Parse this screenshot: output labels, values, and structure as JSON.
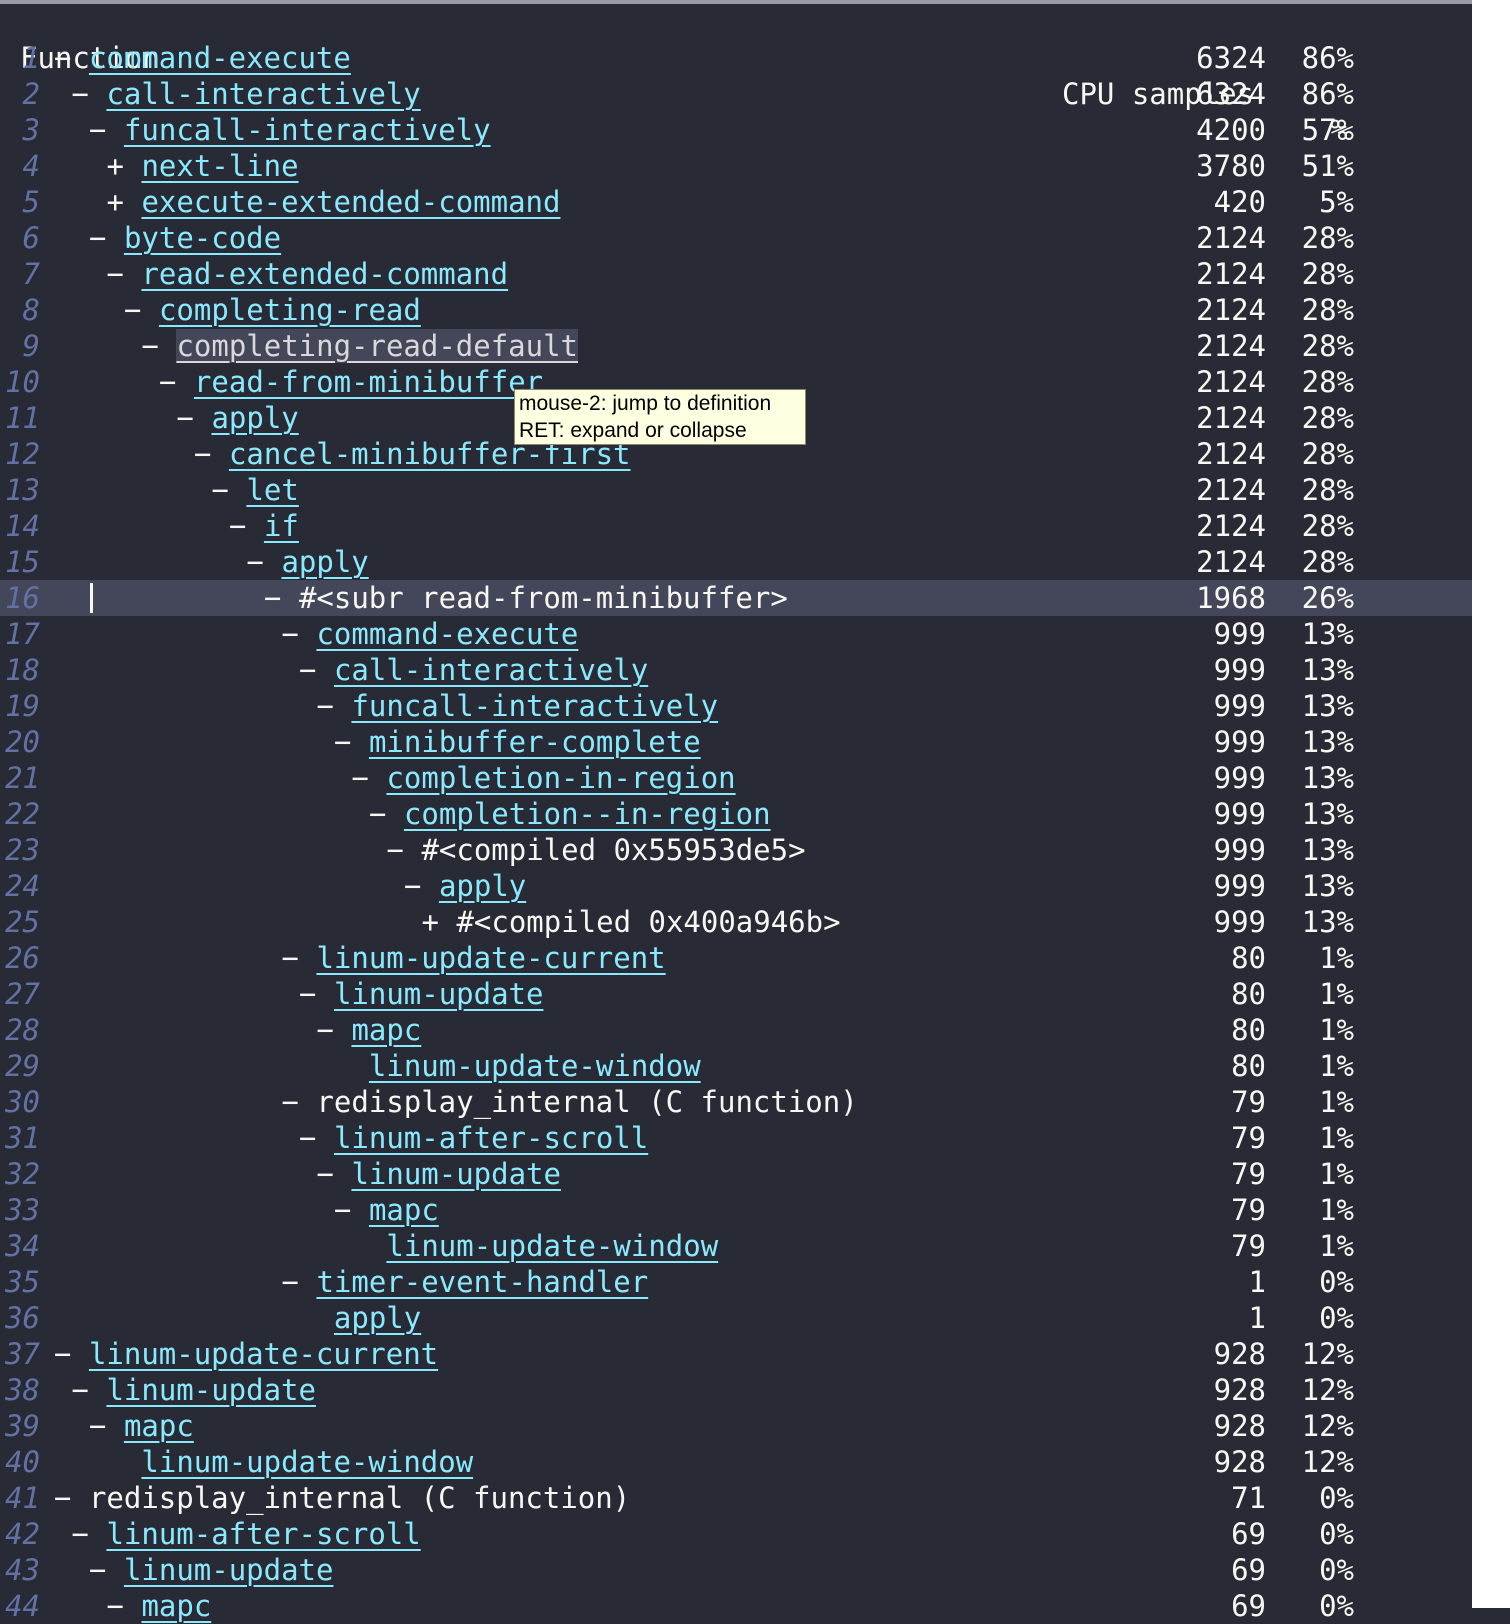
{
  "header": {
    "function": "Function",
    "cpu_samples": "CPU samples",
    "percent": "%"
  },
  "tooltip": {
    "line1": "mouse-2: jump to definition",
    "line2": "RET: expand or collapse"
  },
  "colors": {
    "background": "#282a36",
    "link": "#8be9fd",
    "line_number": "#6272a4",
    "current_line": "#44475a",
    "tooltip_bg": "#ffffe1"
  },
  "rows": [
    {
      "n": "1",
      "indent": 0,
      "sym": "−",
      "name": "command-execute",
      "link": true,
      "samples": "6324",
      "pct": "86%"
    },
    {
      "n": "2",
      "indent": 1,
      "sym": "−",
      "name": "call-interactively",
      "link": true,
      "samples": "6324",
      "pct": "86%"
    },
    {
      "n": "3",
      "indent": 2,
      "sym": "−",
      "name": "funcall-interactively",
      "link": true,
      "samples": "4200",
      "pct": "57%"
    },
    {
      "n": "4",
      "indent": 3,
      "sym": "+",
      "name": "next-line",
      "link": true,
      "samples": "3780",
      "pct": "51%"
    },
    {
      "n": "5",
      "indent": 3,
      "sym": "+",
      "name": "execute-extended-command",
      "link": true,
      "samples": "420",
      "pct": "5%"
    },
    {
      "n": "6",
      "indent": 2,
      "sym": "−",
      "name": "byte-code",
      "link": true,
      "samples": "2124",
      "pct": "28%"
    },
    {
      "n": "7",
      "indent": 3,
      "sym": "−",
      "name": "read-extended-command",
      "link": true,
      "samples": "2124",
      "pct": "28%"
    },
    {
      "n": "8",
      "indent": 4,
      "sym": "−",
      "name": "completing-read",
      "link": true,
      "samples": "2124",
      "pct": "28%"
    },
    {
      "n": "9",
      "indent": 5,
      "sym": "−",
      "name": "completing-read-default",
      "link": true,
      "hover": true,
      "samples": "2124",
      "pct": "28%"
    },
    {
      "n": "10",
      "indent": 6,
      "sym": "−",
      "name": "read-from-minibuffer",
      "link": true,
      "samples": "2124",
      "pct": "28%"
    },
    {
      "n": "11",
      "indent": 7,
      "sym": "−",
      "name": "apply",
      "link": true,
      "samples": "2124",
      "pct": "28%"
    },
    {
      "n": "12",
      "indent": 8,
      "sym": "−",
      "name": "cancel-minibuffer-first",
      "link": true,
      "samples": "2124",
      "pct": "28%"
    },
    {
      "n": "13",
      "indent": 9,
      "sym": "−",
      "name": "let",
      "link": true,
      "samples": "2124",
      "pct": "28%"
    },
    {
      "n": "14",
      "indent": 10,
      "sym": "−",
      "name": "if",
      "link": true,
      "samples": "2124",
      "pct": "28%"
    },
    {
      "n": "15",
      "indent": 11,
      "sym": "−",
      "name": "apply",
      "link": true,
      "samples": "2124",
      "pct": "28%"
    },
    {
      "n": "16",
      "indent": 12,
      "sym": "−",
      "name": "#<subr read-from-minibuffer>",
      "link": false,
      "current": true,
      "samples": "1968",
      "pct": "26%"
    },
    {
      "n": "17",
      "indent": 13,
      "sym": "−",
      "name": "command-execute",
      "link": true,
      "samples": "999",
      "pct": "13%"
    },
    {
      "n": "18",
      "indent": 14,
      "sym": "−",
      "name": "call-interactively",
      "link": true,
      "samples": "999",
      "pct": "13%"
    },
    {
      "n": "19",
      "indent": 15,
      "sym": "−",
      "name": "funcall-interactively",
      "link": true,
      "samples": "999",
      "pct": "13%"
    },
    {
      "n": "20",
      "indent": 16,
      "sym": "−",
      "name": "minibuffer-complete",
      "link": true,
      "samples": "999",
      "pct": "13%"
    },
    {
      "n": "21",
      "indent": 17,
      "sym": "−",
      "name": "completion-in-region",
      "link": true,
      "samples": "999",
      "pct": "13%"
    },
    {
      "n": "22",
      "indent": 18,
      "sym": "−",
      "name": "completion--in-region",
      "link": true,
      "samples": "999",
      "pct": "13%"
    },
    {
      "n": "23",
      "indent": 19,
      "sym": "−",
      "name": "#<compiled 0x55953de5>",
      "link": false,
      "samples": "999",
      "pct": "13%"
    },
    {
      "n": "24",
      "indent": 20,
      "sym": "−",
      "name": "apply",
      "link": true,
      "samples": "999",
      "pct": "13%"
    },
    {
      "n": "25",
      "indent": 21,
      "sym": "+",
      "name": "#<compiled 0x400a946b>",
      "link": false,
      "samples": "999",
      "pct": "13%"
    },
    {
      "n": "26",
      "indent": 13,
      "sym": "−",
      "name": "linum-update-current",
      "link": true,
      "samples": "80",
      "pct": "1%"
    },
    {
      "n": "27",
      "indent": 14,
      "sym": "−",
      "name": "linum-update",
      "link": true,
      "samples": "80",
      "pct": "1%"
    },
    {
      "n": "28",
      "indent": 15,
      "sym": "−",
      "name": "mapc",
      "link": true,
      "samples": "80",
      "pct": "1%"
    },
    {
      "n": "29",
      "indent": 16,
      "sym": "",
      "name": "linum-update-window",
      "link": true,
      "samples": "80",
      "pct": "1%"
    },
    {
      "n": "30",
      "indent": 13,
      "sym": "−",
      "name": "redisplay_internal (C function)",
      "link": false,
      "samples": "79",
      "pct": "1%"
    },
    {
      "n": "31",
      "indent": 14,
      "sym": "−",
      "name": "linum-after-scroll",
      "link": true,
      "samples": "79",
      "pct": "1%"
    },
    {
      "n": "32",
      "indent": 15,
      "sym": "−",
      "name": "linum-update",
      "link": true,
      "samples": "79",
      "pct": "1%"
    },
    {
      "n": "33",
      "indent": 16,
      "sym": "−",
      "name": "mapc",
      "link": true,
      "samples": "79",
      "pct": "1%"
    },
    {
      "n": "34",
      "indent": 17,
      "sym": "",
      "name": "linum-update-window",
      "link": true,
      "samples": "79",
      "pct": "1%"
    },
    {
      "n": "35",
      "indent": 13,
      "sym": "−",
      "name": "timer-event-handler",
      "link": true,
      "samples": "1",
      "pct": "0%"
    },
    {
      "n": "36",
      "indent": 14,
      "sym": "",
      "name": "apply",
      "link": true,
      "samples": "1",
      "pct": "0%"
    },
    {
      "n": "37",
      "indent": 0,
      "sym": "−",
      "name": "linum-update-current",
      "link": true,
      "samples": "928",
      "pct": "12%"
    },
    {
      "n": "38",
      "indent": 1,
      "sym": "−",
      "name": "linum-update",
      "link": true,
      "samples": "928",
      "pct": "12%"
    },
    {
      "n": "39",
      "indent": 2,
      "sym": "−",
      "name": "mapc",
      "link": true,
      "samples": "928",
      "pct": "12%"
    },
    {
      "n": "40",
      "indent": 3,
      "sym": "",
      "name": "linum-update-window",
      "link": true,
      "samples": "928",
      "pct": "12%"
    },
    {
      "n": "41",
      "indent": 0,
      "sym": "−",
      "name": "redisplay_internal (C function)",
      "link": false,
      "samples": "71",
      "pct": "0%"
    },
    {
      "n": "42",
      "indent": 1,
      "sym": "−",
      "name": "linum-after-scroll",
      "link": true,
      "samples": "69",
      "pct": "0%"
    },
    {
      "n": "43",
      "indent": 2,
      "sym": "−",
      "name": "linum-update",
      "link": true,
      "samples": "69",
      "pct": "0%"
    },
    {
      "n": "44",
      "indent": 3,
      "sym": "−",
      "name": "mapc",
      "link": true,
      "samples": "69",
      "pct": "0%"
    }
  ]
}
